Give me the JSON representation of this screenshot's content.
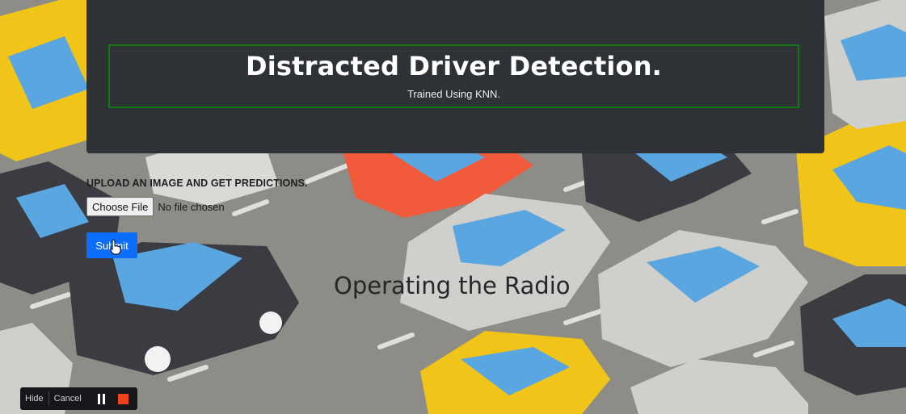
{
  "header": {
    "title": "Distracted Driver Detection.",
    "subtitle": "Trained Using KNN."
  },
  "upload": {
    "label": "UPLOAD AN IMAGE AND GET PREDICTIONS.",
    "choose_file_label": "Choose File",
    "file_status": "No file chosen",
    "submit_label": "Submit"
  },
  "result": {
    "prediction": "Operating the Radio"
  },
  "recorder": {
    "hide_label": "Hide",
    "cancel_label": "Cancel"
  },
  "colors": {
    "header_bg": "#2e3136",
    "title_border": "#0f7a12",
    "submit_bg": "#0d6efd",
    "stop": "#f0421d"
  }
}
